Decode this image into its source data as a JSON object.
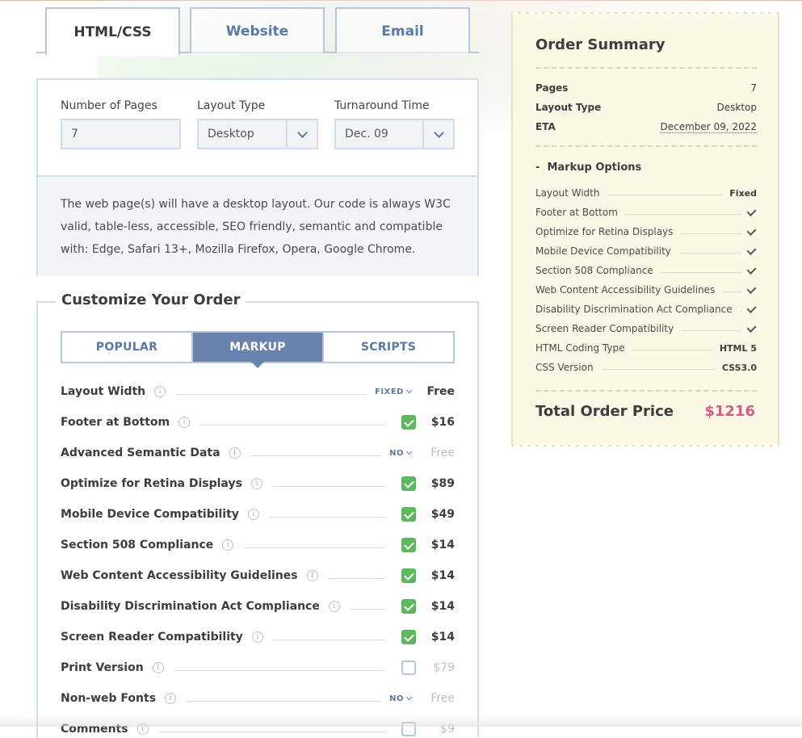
{
  "tabs": [
    "HTML/CSS",
    "Website",
    "Email"
  ],
  "config": {
    "pages_label": "Number of Pages",
    "pages_value": "7",
    "layout_label": "Layout Type",
    "layout_value": "Desktop",
    "turnaround_label": "Turnaround Time",
    "turnaround_value": "Dec. 09",
    "description": "The web page(s) will have a desktop layout. Our code is always W3C valid, table-less, accessible, SEO friendly, semantic and compatible with: Edge, Safari 13+, Mozilla Firefox, Opera, Google Chrome."
  },
  "customize": {
    "title": "Customize Your Order",
    "subtabs": [
      "POPULAR",
      "MARKUP",
      "SCRIPTS"
    ],
    "active_subtab": "MARKUP",
    "options": [
      {
        "label": "Layout Width",
        "control": "dropdown",
        "dropdown_value": "FIXED",
        "price": "Free",
        "muted": false
      },
      {
        "label": "Footer at Bottom",
        "control": "checkbox",
        "checked": true,
        "price": "$16",
        "muted": false
      },
      {
        "label": "Advanced Semantic Data",
        "control": "dropdown",
        "dropdown_value": "NO",
        "price": "Free",
        "muted": true
      },
      {
        "label": "Optimize for Retina Displays",
        "control": "checkbox",
        "checked": true,
        "price": "$89",
        "muted": false
      },
      {
        "label": "Mobile Device Compatibility",
        "control": "checkbox",
        "checked": true,
        "price": "$49",
        "muted": false
      },
      {
        "label": "Section 508 Compliance",
        "control": "checkbox",
        "checked": true,
        "price": "$14",
        "muted": false
      },
      {
        "label": "Web Content Accessibility Guidelines",
        "control": "checkbox",
        "checked": true,
        "price": "$14",
        "muted": false
      },
      {
        "label": "Disability Discrimination Act Compliance",
        "control": "checkbox",
        "checked": true,
        "price": "$14",
        "muted": false
      },
      {
        "label": "Screen Reader Compatibility",
        "control": "checkbox",
        "checked": true,
        "price": "$14",
        "muted": false
      },
      {
        "label": "Print Version",
        "control": "checkbox",
        "checked": false,
        "price": "$79",
        "muted": true
      },
      {
        "label": "Non-web Fonts",
        "control": "dropdown",
        "dropdown_value": "NO",
        "price": "Free",
        "muted": true
      },
      {
        "label": "Comments",
        "control": "checkbox",
        "checked": false,
        "price": "$9",
        "muted": true
      }
    ]
  },
  "summary": {
    "title": "Order Summary",
    "pages_label": "Pages",
    "pages_value": "7",
    "layout_label": "Layout Type",
    "layout_value": "Desktop",
    "eta_label": "ETA",
    "eta_value": "December 09, 2022",
    "markup_heading": "Markup Options",
    "markup_toggle": "-",
    "markup_items": [
      {
        "label": "Layout Width",
        "value": "Fixed"
      },
      {
        "label": "Footer at Bottom",
        "check": true
      },
      {
        "label": "Optimize for Retina Displays",
        "check": true
      },
      {
        "label": "Mobile Device Compatibility",
        "check": true
      },
      {
        "label": "Section 508 Compliance",
        "check": true
      },
      {
        "label": "Web Content Accessibility Guidelines",
        "check": true
      },
      {
        "label": "Disability Discrimination Act Compliance",
        "check": true
      },
      {
        "label": "Screen Reader Compatibility",
        "check": true
      },
      {
        "label": "HTML Coding Type",
        "value": "HTML 5"
      },
      {
        "label": "CSS Version",
        "value": "CSS3.0"
      }
    ],
    "total_label": "Total Order Price",
    "total_value": "$1216"
  },
  "colors": {
    "accent": "#5a79a8",
    "active_tab": "#6883ad",
    "check_green": "#5cb85c",
    "total_pink": "#d45c86",
    "summary_bg": "#fbf9e6"
  }
}
